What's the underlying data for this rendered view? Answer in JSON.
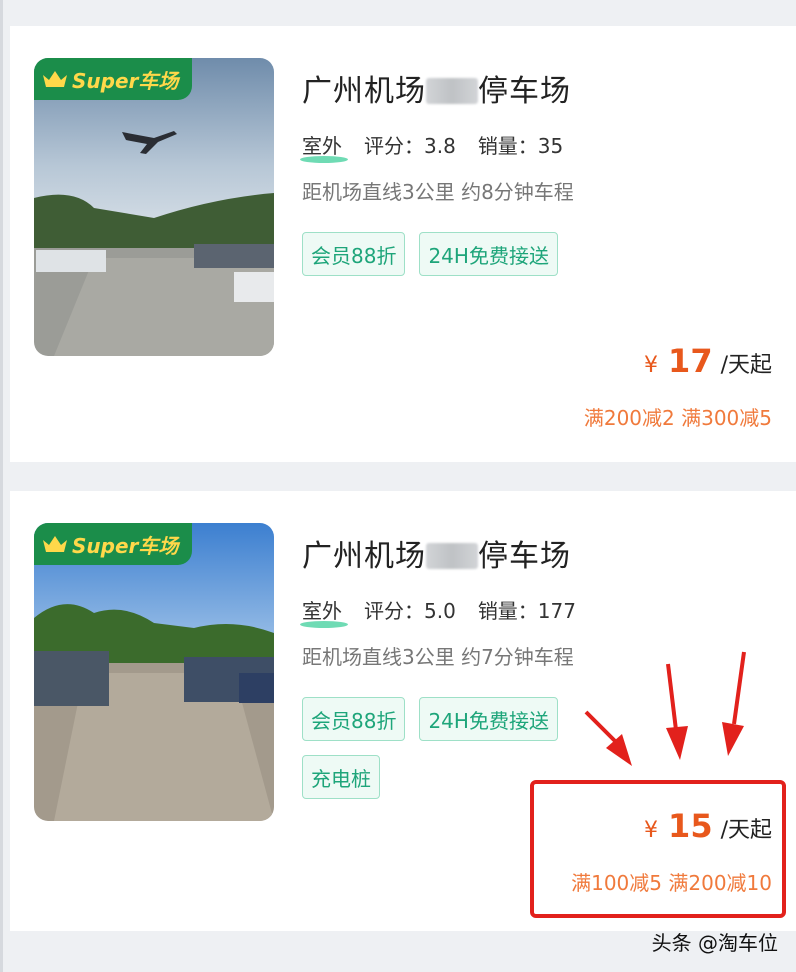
{
  "listings": [
    {
      "badge_label": "Super车场",
      "title_prefix": "广州机场",
      "title_suffix": "停车场",
      "type_label": "室外",
      "rating_label": "评分：3.8",
      "sales_label": "销量：35",
      "distance_text": "距机场直线3公里 约8分钟车程",
      "tags": [
        "会员88折",
        "24H免费接送"
      ],
      "currency": "¥",
      "price": "17",
      "price_unit": "/天起",
      "promo_text": "满200减2 满300减5"
    },
    {
      "badge_label": "Super车场",
      "title_prefix": "广州机场",
      "title_suffix": "停车场",
      "type_label": "室外",
      "rating_label": "评分：5.0",
      "sales_label": "销量：177",
      "distance_text": "距机场直线3公里 约7分钟车程",
      "tags": [
        "会员88折",
        "24H免费接送",
        "充电桩"
      ],
      "currency": "¥",
      "price": "15",
      "price_unit": "/天起",
      "promo_text": "满100减5 满200减10"
    }
  ],
  "watermark": "头条 @淘车位",
  "colors": {
    "accent_green": "#1ea57a",
    "price_orange": "#e8581c",
    "promo_orange": "#f07a3c",
    "annotation_red": "#e2211c",
    "badge_green": "#1b8d4a",
    "badge_text": "#ffd84a"
  }
}
